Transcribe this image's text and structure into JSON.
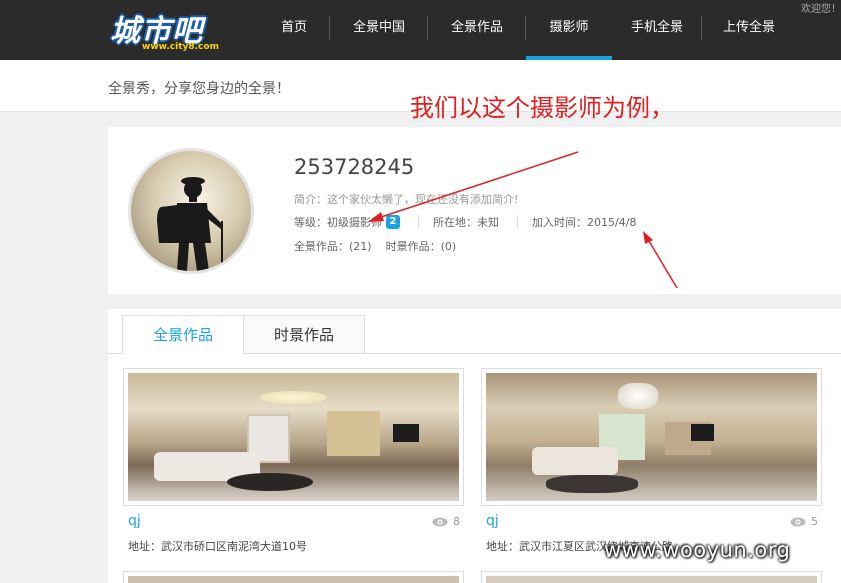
{
  "header": {
    "logo_text": "城市吧",
    "logo_sub": "www.city8.com",
    "welcome": "欢迎您！",
    "nav": [
      {
        "label": "首页"
      },
      {
        "label": "全景中国"
      },
      {
        "label": "全景作品"
      },
      {
        "label": "摄影师"
      },
      {
        "label": "手机全景"
      },
      {
        "label": "上传全景"
      }
    ]
  },
  "subheader": {
    "slogan": "全景秀，分享您身边的全景！"
  },
  "annotation": "我们以这个摄影师为例，",
  "profile": {
    "username": "253728245",
    "intro": "简介：这个家伙太懒了，现在还没有添加简介!",
    "level": "等级：初级摄影师",
    "level_badge": "2",
    "location": "所在地：未知",
    "joined": "加入时间：2015/4/8",
    "pano_count": "全景作品：(21)",
    "timelapse_count": "时景作品：(0)"
  },
  "tabs": [
    {
      "label": "全景作品"
    },
    {
      "label": "时景作品"
    }
  ],
  "works": [
    {
      "title": "qj",
      "views": "8",
      "address": "地址：武汉市硚口区南泥湾大道10号"
    },
    {
      "title": "qj",
      "views": "5",
      "address": "地址：武汉市江夏区武汉绕城高速公路"
    }
  ],
  "watermark": "www.wooyun.org",
  "colors": {
    "accent": "#1aa3e0",
    "nav_bg": "#2b2b2b",
    "annotation": "#e02020"
  }
}
